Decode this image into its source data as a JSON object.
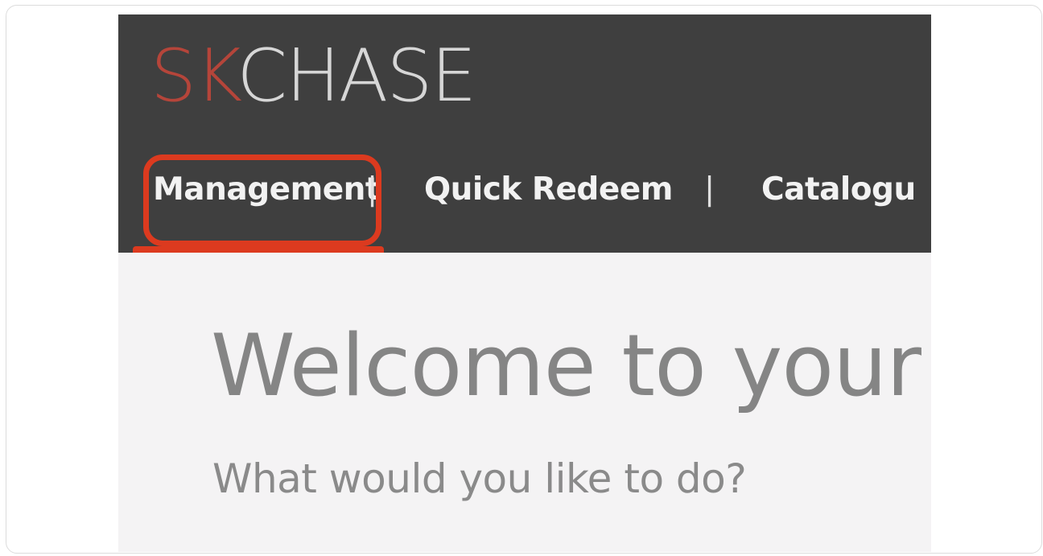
{
  "logo": {
    "part1": "SK",
    "part2": "CHASE",
    "part1_color": "#b5453a",
    "part2_color": "#d6d6d6"
  },
  "nav": {
    "items": [
      {
        "label": "Management",
        "highlighted": true
      },
      {
        "label": "Quick Redeem"
      },
      {
        "label": "Catalogu"
      }
    ],
    "separator": "|"
  },
  "main": {
    "title": "Welcome to your",
    "subtitle": "What would you like to do?"
  },
  "colors": {
    "header_bg": "#3f3f3f",
    "highlight": "#dc3a1f",
    "content_bg": "#f4f3f4",
    "title_text": "#858585"
  }
}
